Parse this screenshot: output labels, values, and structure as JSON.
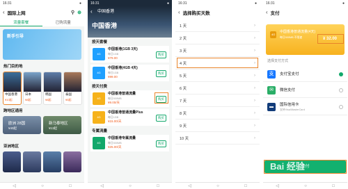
{
  "status": {
    "time": "16:31",
    "battery": "●"
  },
  "p1": {
    "title": "国际上网",
    "tabs": [
      "流量套餐",
      "已购流量"
    ],
    "banner": "新手引导",
    "sec1": "热门目的地",
    "dests": [
      {
        "name": "中国香港",
        "price": "¥10起"
      },
      {
        "name": "日本",
        "price": "¥8起"
      },
      {
        "name": "韩国",
        "price": "¥8起"
      },
      {
        "name": "泰国",
        "price": "¥5起"
      }
    ],
    "sec2": "跨地区通用",
    "multi": [
      {
        "name": "欧洲 28国",
        "price": "¥40起"
      },
      {
        "name": "新马泰地区",
        "price": "¥13起"
      }
    ],
    "sec3": "亚洲地区",
    "nav": [
      "◁",
      "○",
      "□"
    ]
  },
  "p2": {
    "title": "中国香港",
    "hero": "中国香港",
    "sec1": "按天套餐",
    "items": [
      {
        "name": "中国香港(1GB 3天)",
        "sub": "每日1GB",
        "price": "¥79.00",
        "btn": "购买",
        "tag": "4G"
      },
      {
        "name": "中国香港(4GB 4天)",
        "sub": "每日1GB",
        "price": "¥99.00",
        "btn": "购买",
        "tag": "4G"
      }
    ],
    "sec2": "按天付费",
    "items2": [
      {
        "name": "中国香港普通流量",
        "sub": "每日500MB",
        "price": "¥9.00/天",
        "btn": "购买",
        "tag": "4G"
      },
      {
        "name": "中国香港普通流量Plus",
        "sub": "每日1GB",
        "price": "¥15.00/天",
        "btn": "购买",
        "tag": "4G",
        "badge": "热"
      }
    ],
    "sec3": "专属流量",
    "items3": [
      {
        "name": "中国香港专属流量",
        "sub": "每日500MB",
        "price": "¥25.00/天",
        "btn": "购买",
        "tag": "4G"
      }
    ],
    "nav": [
      "◁",
      "○",
      "□"
    ]
  },
  "p3": {
    "title": "选择购买天数",
    "days": [
      "1 天",
      "2 天",
      "3 天",
      "4 天",
      "5 天",
      "6 天",
      "7 天",
      "8 天",
      "9 天",
      "10 天"
    ],
    "nav": [
      "◁",
      "○",
      "□"
    ]
  },
  "p4": {
    "title": "支付",
    "card_name": "中国香港普通流量(4天)",
    "card_sub": "每日500MB 不限速",
    "price": "¥ 32.00",
    "sec": "选择支付方式",
    "methods": [
      {
        "name": "支付宝支付",
        "sub": ""
      },
      {
        "name": "微信支付",
        "sub": ""
      },
      {
        "name": "国际信用卡",
        "sub": "支持Visa/MasterCard"
      }
    ],
    "pay_btn": "支付",
    "watermark": "Bai 经验",
    "nav": [
      "◁",
      "○",
      "□"
    ]
  }
}
